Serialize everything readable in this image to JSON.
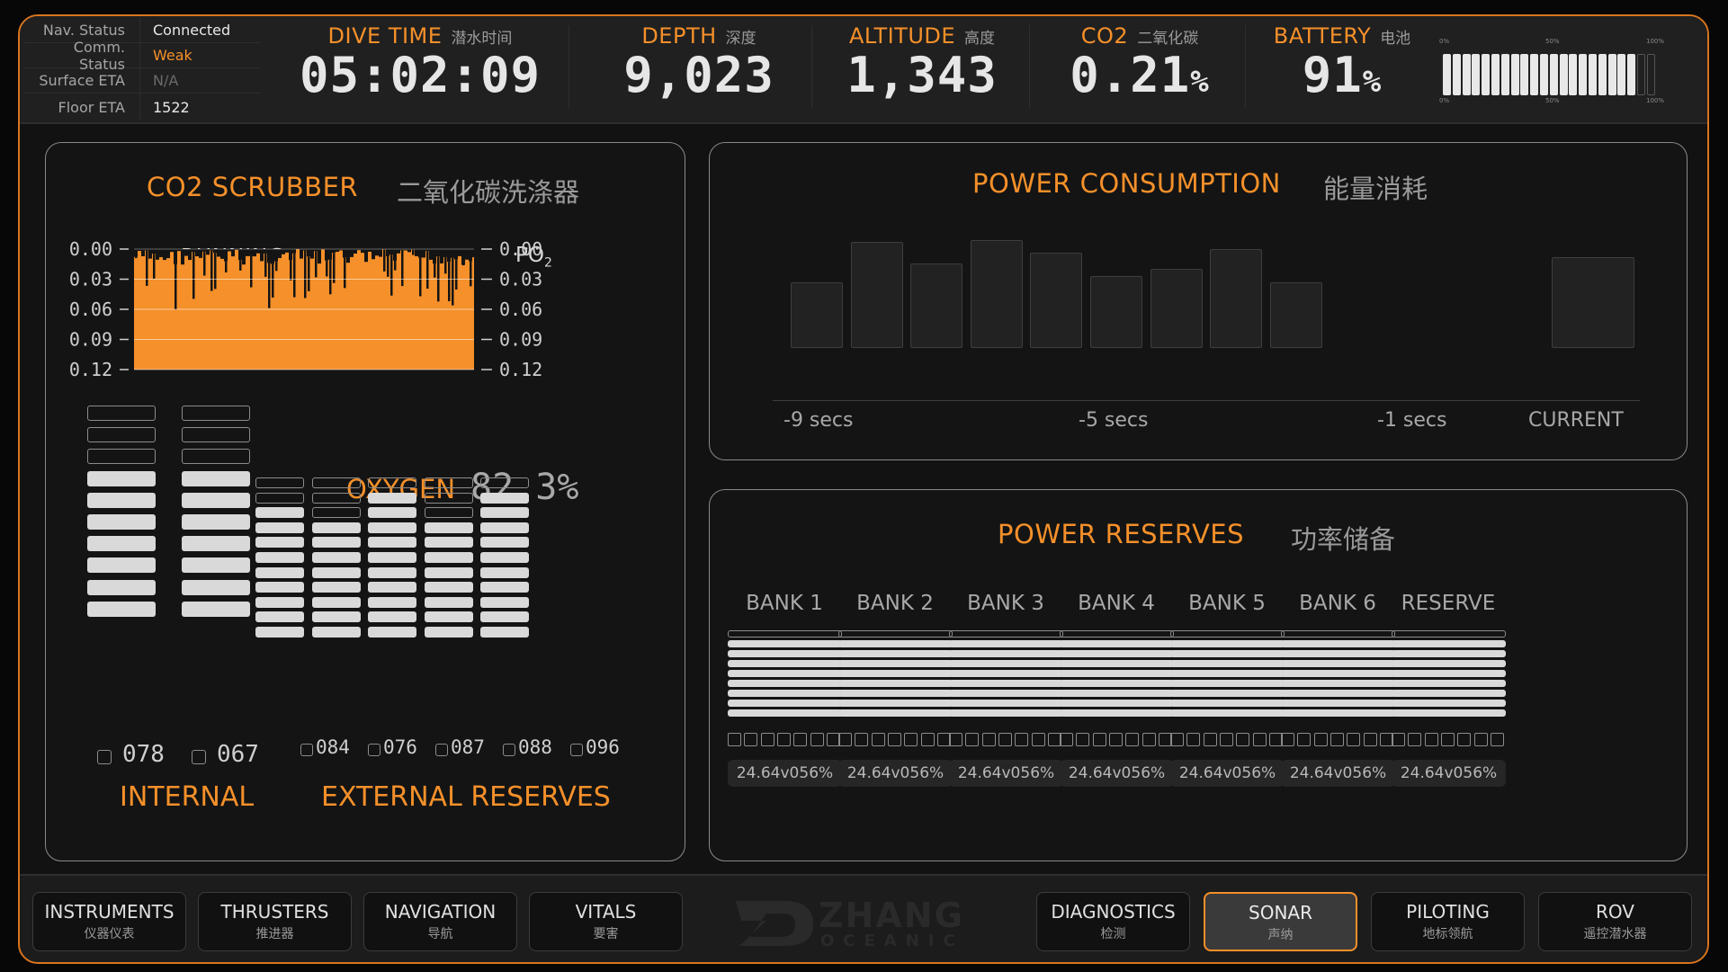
{
  "status": {
    "rows": [
      {
        "key": "Nav. Status",
        "value": "Connected"
      },
      {
        "key": "Comm. Status",
        "value": "Weak"
      },
      {
        "key": "Surface ETA",
        "value": "N/A"
      },
      {
        "key": "Floor ETA",
        "value": "1522"
      }
    ]
  },
  "metrics": {
    "dive_time": {
      "label": "DIVE TIME",
      "cn": "潜水时间",
      "value": "05:02:09"
    },
    "depth": {
      "label": "DEPTH",
      "cn": "深度",
      "value": "9,023"
    },
    "altitude": {
      "label": "ALTITUDE",
      "cn": "高度",
      "value": "1,343"
    },
    "co2": {
      "label": "CO2",
      "cn": "二氧化碳",
      "value": "0.21",
      "unit": "%"
    },
    "battery": {
      "label": "BATTERY",
      "cn": "电池",
      "value": "91",
      "unit": "%",
      "scale": [
        "0%",
        "50%",
        "100%"
      ],
      "level": 0.91
    }
  },
  "scrubber": {
    "title": "CO2 SCRUBBER",
    "cn": "二氧化碳洗涤器",
    "status": "RUNNING",
    "right_label": "PO",
    "right_sub": "2",
    "ticks": [
      "0.00",
      "0.03",
      "0.06",
      "0.09",
      "0.12"
    ]
  },
  "oxygen": {
    "title": "OXYGEN",
    "value": "82.3%",
    "internal": {
      "label": "INTERNAL",
      "tanks": [
        {
          "value": "078",
          "level": 7
        },
        {
          "value": "067",
          "level": 7
        }
      ],
      "rows": 10
    },
    "external": {
      "label": "EXTERNAL RESERVES",
      "tanks": [
        {
          "value": "084",
          "level": 9
        },
        {
          "value": "076",
          "level": 8
        },
        {
          "value": "087",
          "level": 10
        },
        {
          "value": "088",
          "level": 8
        },
        {
          "value": "096",
          "level": 10
        }
      ],
      "rows": 11
    }
  },
  "power_consumption": {
    "title": "POWER CONSUMPTION",
    "cn": "能量消耗",
    "labels": [
      "-9 secs",
      "-5 secs",
      "-1 secs",
      "CURRENT"
    ],
    "values": [
      0.62,
      1.0,
      0.8,
      1.02,
      0.9,
      0.68,
      0.75,
      0.93,
      0.62
    ],
    "current": 0.86
  },
  "power_reserves": {
    "title": "POWER RESERVES",
    "cn": "功率储备",
    "banks": [
      {
        "name": "BANK 1",
        "reading": "24.64v056%"
      },
      {
        "name": "BANK 2",
        "reading": "24.64v056%"
      },
      {
        "name": "BANK 3",
        "reading": "24.64v056%"
      },
      {
        "name": "BANK 4",
        "reading": "24.64v056%"
      },
      {
        "name": "BANK 5",
        "reading": "24.64v056%"
      },
      {
        "name": "BANK 6",
        "reading": "24.64v056%"
      },
      {
        "name": "RESERVE",
        "reading": "24.64v056%"
      }
    ]
  },
  "nav": {
    "left": [
      {
        "l1": "INSTRUMENTS",
        "l2": "仪器仪表"
      },
      {
        "l1": "THRUSTERS",
        "l2": "推进器"
      },
      {
        "l1": "NAVIGATION",
        "l2": "导航"
      },
      {
        "l1": "VITALS",
        "l2": "要害"
      }
    ],
    "right": [
      {
        "l1": "DIAGNOSTICS",
        "l2": "检测"
      },
      {
        "l1": "SONAR",
        "l2": "声纳",
        "active": true
      },
      {
        "l1": "PILOTING",
        "l2": "地标领航"
      },
      {
        "l1": "ROV",
        "l2": "遥控潜水器"
      }
    ],
    "brand": "ZHANG",
    "brand_sub": "OCEANIC"
  },
  "colors": {
    "accent": "#f5902a",
    "bg": "#121212",
    "fill": "#d9d9d9"
  }
}
